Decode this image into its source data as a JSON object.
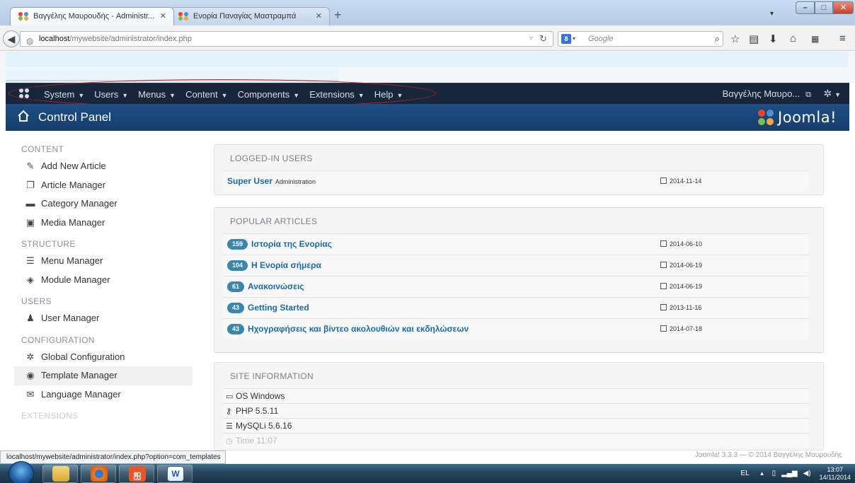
{
  "browser": {
    "tabs": [
      {
        "title": "Βαγγέλης Μαυρουδής - Administr...",
        "active": true
      },
      {
        "title": "Ενορία Παναγίας Μαστραμπά",
        "active": false
      }
    ],
    "new_tab": "+",
    "url_host": "localhost",
    "url_path": "/mywebsite/administrator/index.php",
    "search_placeholder": "Google",
    "status_url": "localhost/mywebsite/administrator/index.php?option=com_templates"
  },
  "admin_menu": {
    "items": [
      "System",
      "Users",
      "Menus",
      "Content",
      "Components",
      "Extensions",
      "Help"
    ],
    "user": "Βαγγέλης Μαυρο..."
  },
  "header": {
    "title": "Control Panel",
    "brand": "Joomla!"
  },
  "sidebar": {
    "sections": [
      {
        "title": "CONTENT",
        "items": [
          {
            "label": "Add New Article",
            "icon": "pencil-icon"
          },
          {
            "label": "Article Manager",
            "icon": "stack-icon"
          },
          {
            "label": "Category Manager",
            "icon": "folder-icon"
          },
          {
            "label": "Media Manager",
            "icon": "image-icon"
          }
        ]
      },
      {
        "title": "STRUCTURE",
        "items": [
          {
            "label": "Menu Manager",
            "icon": "list-icon"
          },
          {
            "label": "Module Manager",
            "icon": "cube-icon"
          }
        ]
      },
      {
        "title": "USERS",
        "items": [
          {
            "label": "User Manager",
            "icon": "users-icon"
          }
        ]
      },
      {
        "title": "CONFIGURATION",
        "items": [
          {
            "label": "Global Configuration",
            "icon": "cog-icon"
          },
          {
            "label": "Template Manager",
            "icon": "eye-icon",
            "active": true
          },
          {
            "label": "Language Manager",
            "icon": "comments-icon"
          }
        ]
      },
      {
        "title": "EXTENSIONS",
        "items": []
      }
    ]
  },
  "logged_in_users": {
    "title": "LOGGED-IN USERS",
    "rows": [
      {
        "name": "Super User",
        "sub": "Administration",
        "date": "2014-11-14"
      }
    ]
  },
  "popular_articles": {
    "title": "POPULAR ARTICLES",
    "rows": [
      {
        "hits": "159",
        "title": "Ιστορία της Ενορίας",
        "date": "2014-06-10"
      },
      {
        "hits": "104",
        "title": "Η Ενορία σήμερα",
        "date": "2014-06-19"
      },
      {
        "hits": "61",
        "title": "Ανακοινώσεις",
        "date": "2014-06-19"
      },
      {
        "hits": "43",
        "title": "Getting Started",
        "date": "2013-11-16"
      },
      {
        "hits": "43",
        "title": "Ηχογραφήσεις και βίντεο ακολουθιών και εκδηλώσεων",
        "date": "2014-07-18"
      }
    ]
  },
  "site_information": {
    "title": "SITE INFORMATION",
    "rows": [
      {
        "icon": "monitor-icon",
        "text": "OS Windows"
      },
      {
        "icon": "key-icon",
        "text": "PHP 5.5.11"
      },
      {
        "icon": "database-icon",
        "text": "MySQLi 5.6.16"
      },
      {
        "icon": "clock-icon",
        "text": "Time 11:07"
      }
    ]
  },
  "footer": "Joomla! 3.3.3 — © 2014 Βαγγέλης Μαυρουδής",
  "taskbar": {
    "lang": "EL",
    "time": "13:07",
    "date": "14/11/2014"
  }
}
